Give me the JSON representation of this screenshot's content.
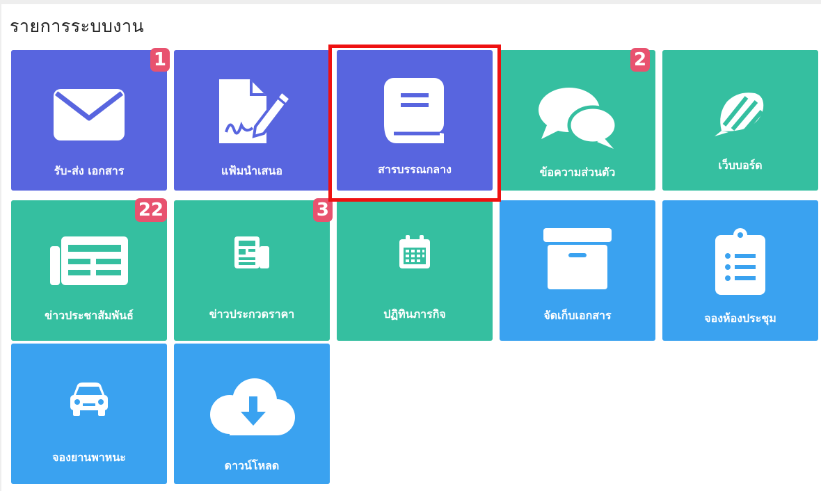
{
  "heading": "รายการระบบงาน",
  "colors": {
    "blue": "#5865df",
    "green": "#35bfa0",
    "sky": "#3aa2f0",
    "badge": "#e8526f",
    "highlight": "#ee1111"
  },
  "tiles": [
    {
      "label": "รับ-ส่ง เอกสาร",
      "icon": "envelope-icon",
      "badge": "1"
    },
    {
      "label": "แฟ้มนำเสนอ",
      "icon": "signed-document-icon"
    },
    {
      "label": "สารบรรณกลาง",
      "icon": "book-icon",
      "selected": true
    },
    {
      "label": "ข้อความส่วนตัว",
      "icon": "chat-bubbles-icon",
      "badge": "2"
    },
    {
      "label": "เว็บบอร์ด",
      "icon": "webboard-icon"
    },
    {
      "label": "ข่าวประชาสัมพันธ์",
      "icon": "newspaper-icon",
      "badge": "22"
    },
    {
      "label": "ข่าวประกวดราคา",
      "icon": "small-newspaper-icon",
      "badge": "3"
    },
    {
      "label": "ปฏิทินภารกิจ",
      "icon": "calendar-icon"
    },
    {
      "label": "จัดเก็บเอกสาร",
      "icon": "archive-box-icon"
    },
    {
      "label": "จองห้องประชุม",
      "icon": "clipboard-list-icon"
    },
    {
      "label": "จองยานพาหนะ",
      "icon": "car-icon"
    },
    {
      "label": "ดาวน์โหลด",
      "icon": "cloud-download-icon"
    }
  ]
}
